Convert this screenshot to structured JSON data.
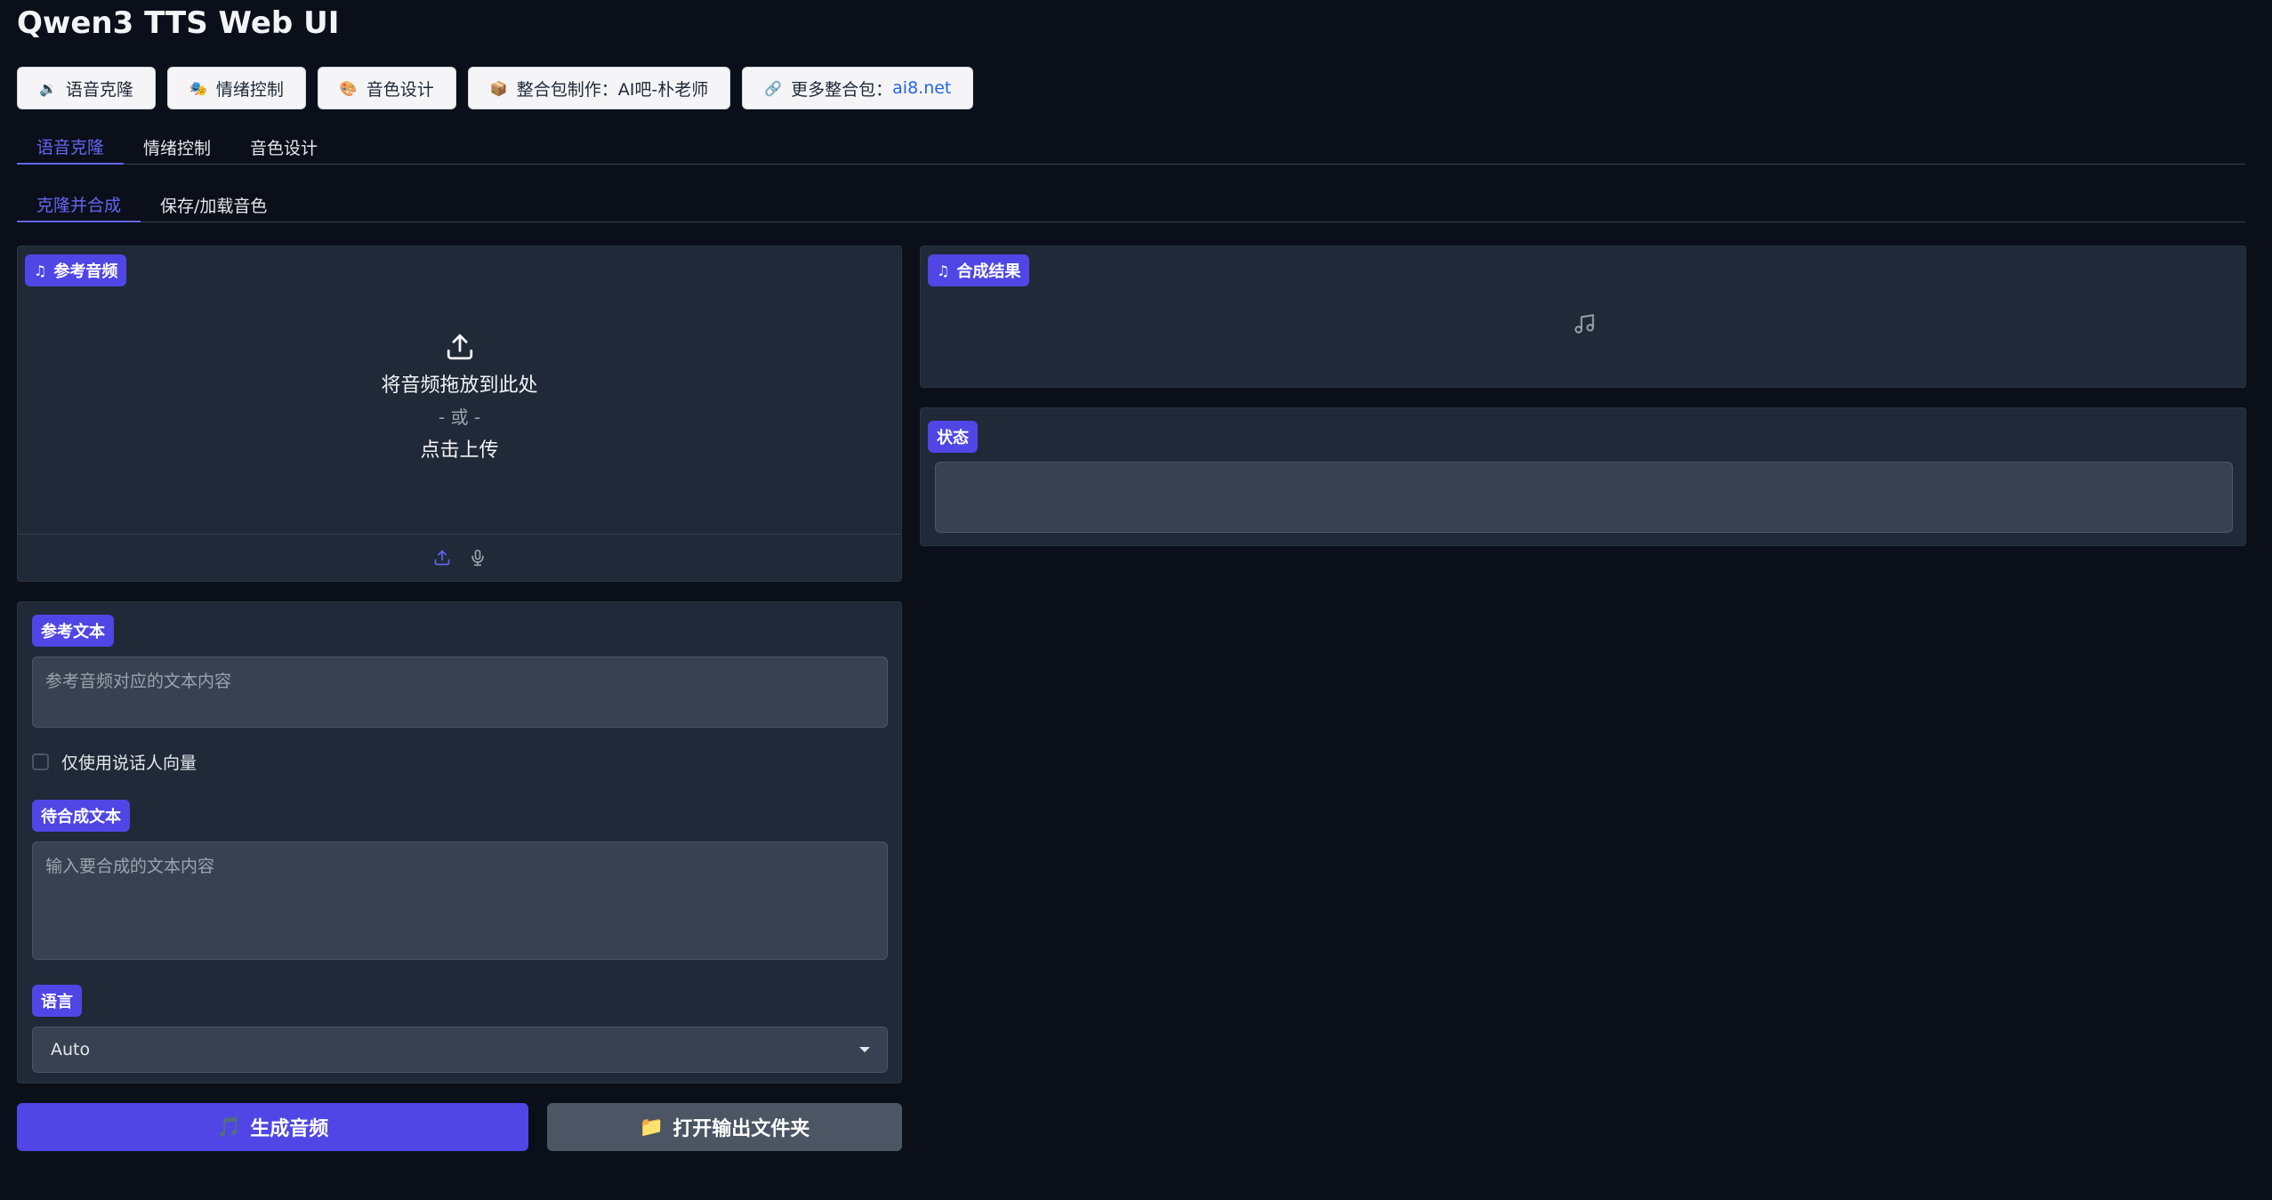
{
  "app": {
    "title": "Qwen3 TTS Web UI"
  },
  "top_buttons": [
    {
      "icon": "speaker-icon",
      "label": "语音克隆"
    },
    {
      "icon": "masks-icon",
      "label": "情绪控制"
    },
    {
      "icon": "palette-icon",
      "label": "音色设计"
    },
    {
      "icon": "package-icon",
      "label": "整合包制作：AI吧-朴老师"
    },
    {
      "icon": "link-icon",
      "label": "更多整合包：",
      "link": "ai8.net"
    }
  ],
  "main_tabs": [
    "语音克隆",
    "情绪控制",
    "音色设计"
  ],
  "sub_tabs": [
    "克隆并合成",
    "保存/加载音色"
  ],
  "ref_audio": {
    "label": "参考音频",
    "drop_text": "将音频拖放到此处",
    "or_text": "- 或 -",
    "click_text": "点击上传"
  },
  "ref_text": {
    "label": "参考文本",
    "placeholder": "参考音频对应的文本内容"
  },
  "speaker_only": {
    "label": "仅使用说话人向量"
  },
  "synth_text": {
    "label": "待合成文本",
    "placeholder": "输入要合成的文本内容"
  },
  "language": {
    "label": "语言",
    "value": "Auto"
  },
  "actions": {
    "generate": "生成音频",
    "open_folder": "打开输出文件夹"
  },
  "result": {
    "label": "合成结果"
  },
  "status": {
    "label": "状态",
    "value": ""
  },
  "colors": {
    "accent": "#4f46e5",
    "background": "#0b0f19",
    "panel": "#1f2937"
  }
}
